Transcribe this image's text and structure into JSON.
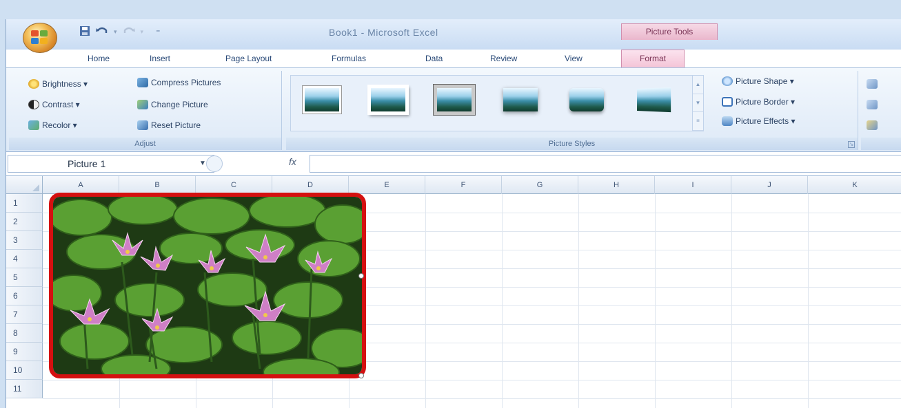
{
  "window": {
    "title": "Book1 - Microsoft Excel"
  },
  "quick_access": {
    "save_icon": "save-icon",
    "undo_icon": "undo-icon",
    "redo_icon": "redo-icon",
    "customize_icon": "dropdown-icon"
  },
  "context_tab_group": "Picture Tools",
  "tabs": [
    {
      "label": "Home"
    },
    {
      "label": "Insert"
    },
    {
      "label": "Page Layout"
    },
    {
      "label": "Formulas"
    },
    {
      "label": "Data"
    },
    {
      "label": "Review"
    },
    {
      "label": "View"
    },
    {
      "label": "Format",
      "active": true
    }
  ],
  "ribbon": {
    "adjust": {
      "label": "Adjust",
      "brightness": "Brightness ▾",
      "contrast": "Contrast ▾",
      "recolor": "Recolor ▾",
      "compress": "Compress Pictures",
      "change": "Change Picture",
      "reset": "Reset Picture"
    },
    "picture_styles": {
      "label": "Picture Styles",
      "picture_shape": "Picture Shape ▾",
      "picture_border": "Picture Border ▾",
      "picture_effects": "Picture Effects ▾"
    }
  },
  "formula_bar": {
    "name_box": "Picture 1",
    "fx": "fx"
  },
  "columns": [
    "A",
    "B",
    "C",
    "D",
    "E",
    "F",
    "G",
    "H",
    "I",
    "J",
    "K"
  ],
  "rows": [
    "1",
    "2",
    "3",
    "4",
    "5",
    "6",
    "7",
    "8",
    "9",
    "10",
    "11"
  ],
  "colors": {
    "ribbon_bg": "#dde9f7",
    "context_tab": "#f4c4d7",
    "picture_border": "#d41010"
  }
}
